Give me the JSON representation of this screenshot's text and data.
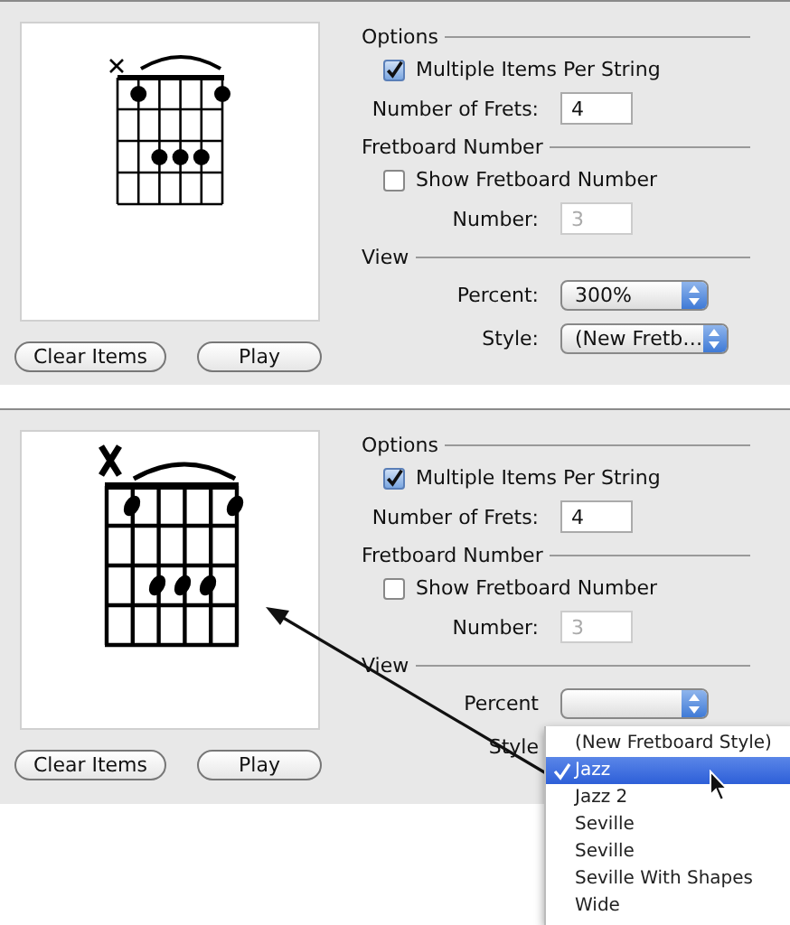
{
  "panels": [
    {
      "chord_diagram": {
        "kind": "plain"
      },
      "arrow": false,
      "buttons": [
        "Clear Items",
        "Play"
      ],
      "options": {
        "heading": "Options",
        "multiple": {
          "label": "Multiple Items Per String",
          "checked": true
        },
        "frets": {
          "label": "Number of Frets:",
          "value": "4"
        }
      },
      "fretboard": {
        "heading": "Fretboard Number",
        "show": {
          "label": "Show Fretboard Number",
          "checked": false
        },
        "number": {
          "label": "Number:",
          "value": "3",
          "disabled": true
        }
      },
      "view": {
        "heading": "View",
        "percent": {
          "label": "Percent:",
          "value": "300%"
        },
        "style": {
          "label": "Style:",
          "value": "(New Fretb…"
        }
      }
    },
    {
      "chord_diagram": {
        "kind": "jazz"
      },
      "arrow": true,
      "buttons": [
        "Clear Items",
        "Play"
      ],
      "options": {
        "heading": "Options",
        "multiple": {
          "label": "Multiple Items Per String",
          "checked": true
        },
        "frets": {
          "label": "Number of Frets:",
          "value": "4"
        }
      },
      "fretboard": {
        "heading": "Fretboard Number",
        "show": {
          "label": "Show Fretboard Number",
          "checked": false
        },
        "number": {
          "label": "Number:",
          "value": "3",
          "disabled": true
        }
      },
      "view": {
        "heading": "View",
        "percent": {
          "label": "Percent"
        },
        "style": {
          "label": "Style"
        }
      }
    }
  ],
  "style_menu": {
    "items": [
      {
        "label": "(New Fretboard Style)",
        "selected": false
      },
      {
        "label": "Jazz",
        "selected": true
      },
      {
        "label": "Jazz 2",
        "selected": false
      },
      {
        "label": "Seville",
        "selected": false
      },
      {
        "label": "Seville",
        "selected": false
      },
      {
        "label": "Seville With Shapes",
        "selected": false
      },
      {
        "label": "Wide",
        "selected": false
      }
    ]
  }
}
